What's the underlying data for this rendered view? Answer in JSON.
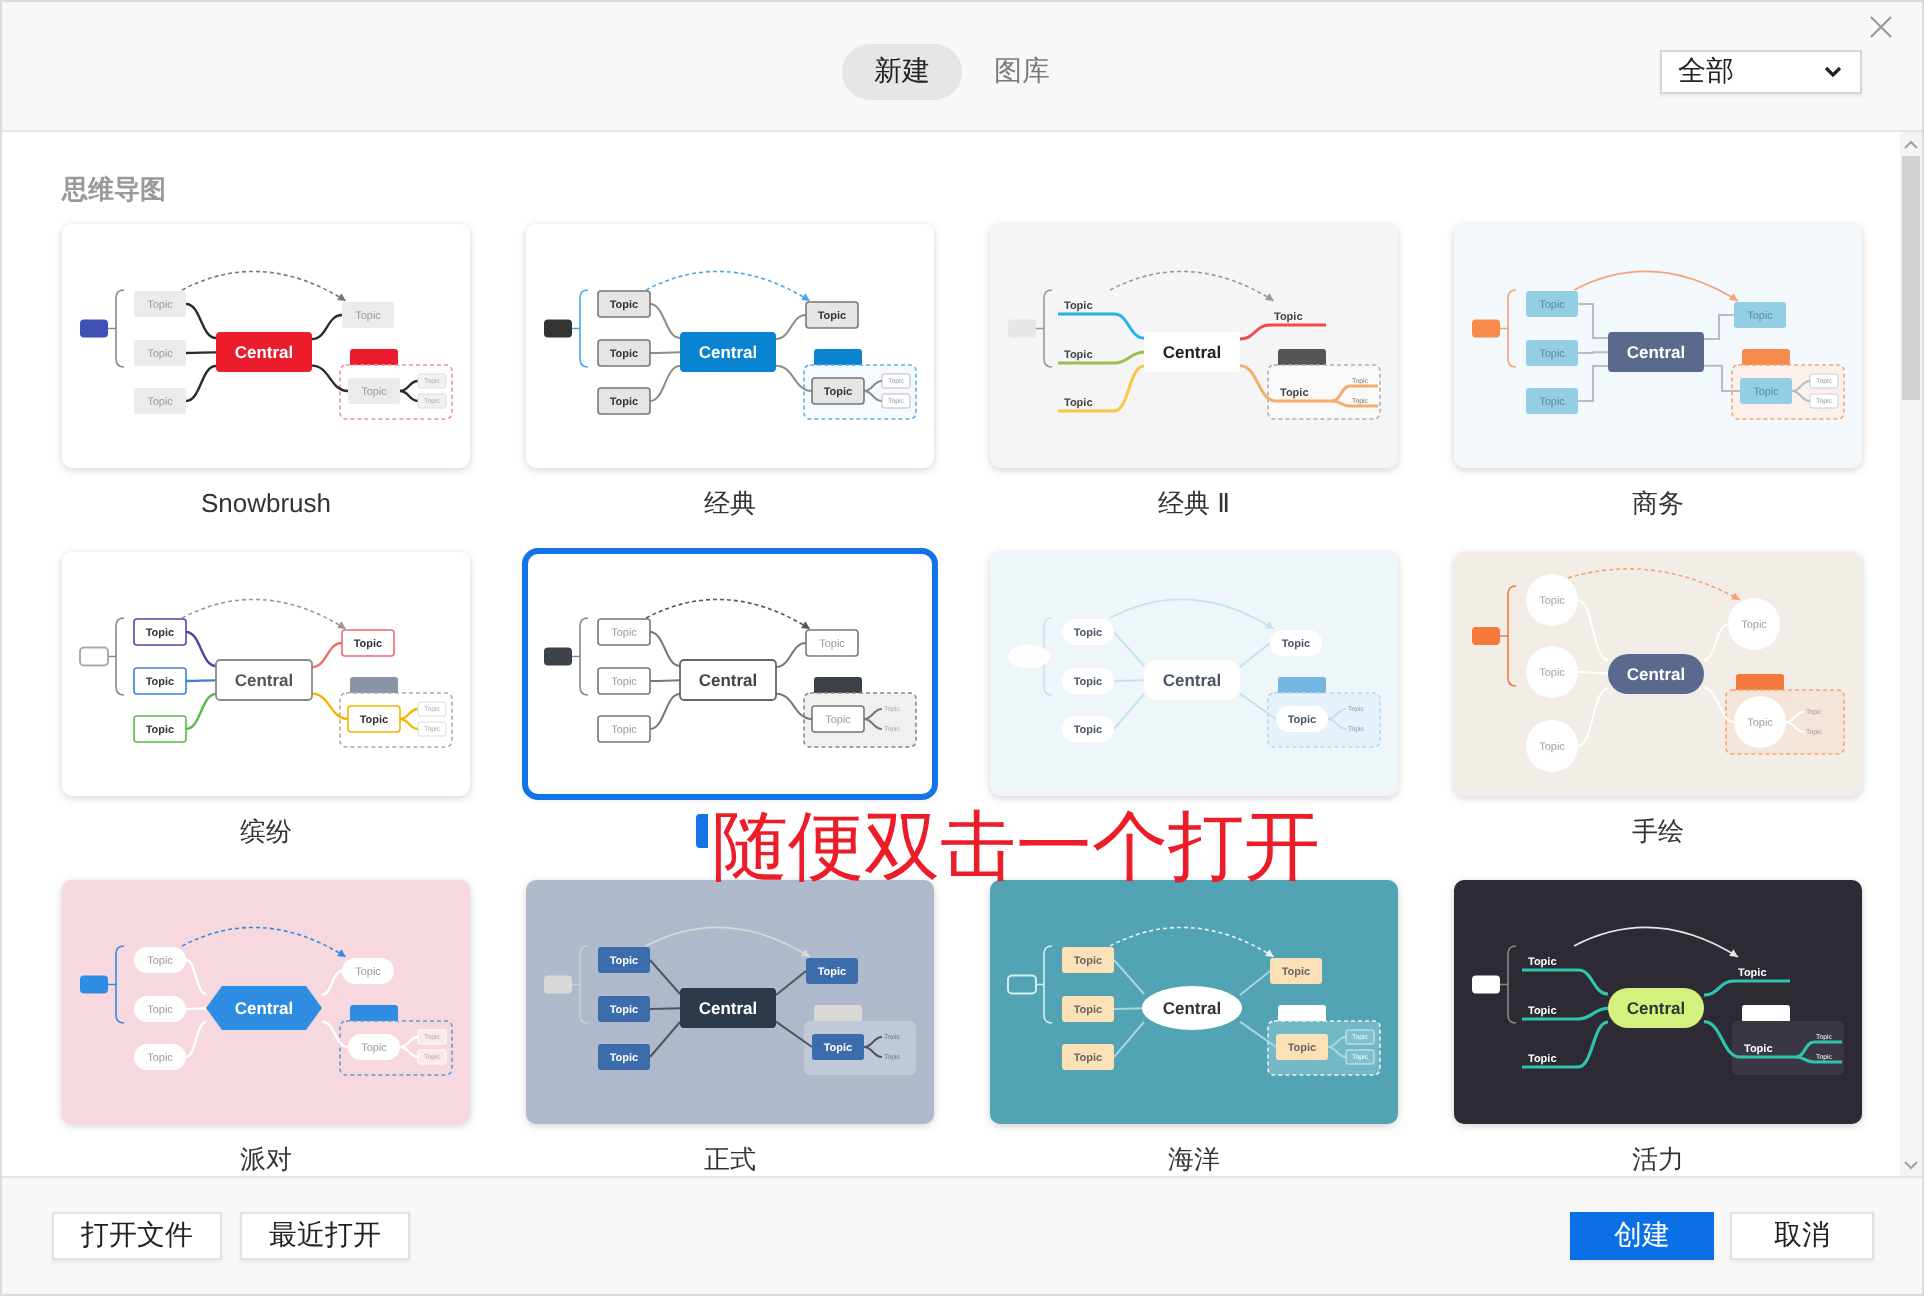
{
  "tabs": [
    {
      "label": "新建",
      "selected": true
    },
    {
      "label": "图库",
      "selected": false
    }
  ],
  "filter": {
    "value": "全部"
  },
  "section": {
    "title": "思维导图"
  },
  "templates": [
    {
      "label": "Snowbrush",
      "kind": "snowbrush",
      "selected": false,
      "central": "Central",
      "topics": [
        "Topic",
        "Topic",
        "Topic",
        "Topic",
        "Topic"
      ],
      "subtopics": [
        "Topic",
        "Topic"
      ]
    },
    {
      "label": "经典",
      "kind": "classic",
      "selected": false,
      "central": "Central",
      "topics": [
        "Topic",
        "Topic",
        "Topic",
        "Topic",
        "Topic"
      ],
      "subtopics": [
        "Topic",
        "Topic"
      ]
    },
    {
      "label": "经典 Ⅱ",
      "kind": "classic2",
      "selected": false,
      "central": "Central",
      "topics": [
        "Topic",
        "Topic",
        "Topic",
        "Topic",
        "Topic"
      ],
      "subtopics": [
        "Topic",
        "Topic"
      ]
    },
    {
      "label": "商务",
      "kind": "business",
      "selected": false,
      "central": "Central",
      "topics": [
        "Topic",
        "Topic",
        "Topic",
        "Topic",
        "Topic"
      ],
      "subtopics": [
        "Topic",
        "Topic"
      ]
    },
    {
      "label": "缤纷",
      "kind": "colorful",
      "selected": false,
      "central": "Central",
      "topics": [
        "Topic",
        "Topic",
        "Topic",
        "Topic",
        "Topic"
      ],
      "subtopics": [
        "Topic",
        "Topic"
      ]
    },
    {
      "kind": "simple",
      "selected": true,
      "central": "Central",
      "topics": [
        "Topic",
        "Topic",
        "Topic",
        "Topic",
        "Topic"
      ],
      "subtopics": [
        "Topic",
        "Topic"
      ]
    },
    {
      "kind": "fresh",
      "selected": false,
      "central": "Central",
      "topics": [
        "Topic",
        "Topic",
        "Topic",
        "Topic",
        "Topic"
      ],
      "subtopics": [
        "Topic",
        "Topic"
      ]
    },
    {
      "label": "手绘",
      "kind": "handdrawn",
      "selected": false,
      "central": "Central",
      "topics": [
        "Topic",
        "Topic",
        "Topic",
        "Topic",
        "Topic"
      ],
      "subtopics": [
        "Topic",
        "Topic"
      ]
    },
    {
      "label": "派对",
      "kind": "party",
      "selected": false,
      "central": "Central",
      "topics": [
        "Topic",
        "Topic",
        "Topic",
        "Topic",
        "Topic"
      ],
      "subtopics": [
        "Topic",
        "Topic"
      ]
    },
    {
      "label": "正式",
      "kind": "formal",
      "selected": false,
      "central": "Central",
      "topics": [
        "Topic",
        "Topic",
        "Topic",
        "Topic",
        "Topic"
      ],
      "subtopics": [
        "Topic",
        "Topic"
      ]
    },
    {
      "label": "海洋",
      "kind": "ocean",
      "selected": false,
      "central": "Central",
      "topics": [
        "Topic",
        "Topic",
        "Topic",
        "Topic",
        "Topic"
      ],
      "subtopics": [
        "Topic",
        "Topic"
      ]
    },
    {
      "label": "活力",
      "kind": "vibrant",
      "selected": false,
      "central": "Central",
      "topics": [
        "Topic",
        "Topic",
        "Topic",
        "Topic",
        "Topic"
      ],
      "subtopics": [
        "Topic",
        "Topic"
      ]
    }
  ],
  "footer": {
    "left_buttons": [
      "打开文件",
      "最近打开"
    ],
    "right_buttons": [
      {
        "label": "创建",
        "kind": "primary"
      },
      {
        "label": "取消",
        "kind": "secondary"
      }
    ]
  },
  "annotation": {
    "text": "随便双击一个打开"
  }
}
